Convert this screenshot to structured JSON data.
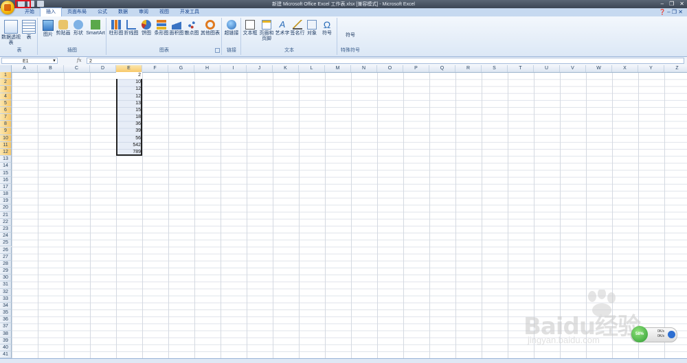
{
  "window": {
    "title": "新建 Microsoft Office Excel 工作表.xlsx [兼容模式] - Microsoft Excel",
    "controls": [
      "–",
      "❐",
      "✕"
    ]
  },
  "tabs": [
    "开始",
    "插入",
    "页面布局",
    "公式",
    "数据",
    "审阅",
    "视图",
    "开发工具"
  ],
  "active_tab": "插入",
  "ribbon": {
    "groups": [
      {
        "label": "表",
        "buttons": [
          "数据透视表",
          "表"
        ]
      },
      {
        "label": "插图",
        "buttons": [
          "图片",
          "剪贴画",
          "形状",
          "SmartArt"
        ]
      },
      {
        "label": "图表",
        "buttons": [
          "柱形图",
          "折线图",
          "饼图",
          "条形图",
          "面积图",
          "散点图",
          "其他图表"
        ]
      },
      {
        "label": "链接",
        "buttons": [
          "超链接"
        ]
      },
      {
        "label": "文本",
        "buttons": [
          "文本框",
          "页眉和页脚",
          "艺术字",
          "签名行",
          "对象",
          "符号"
        ]
      },
      {
        "label": "特殊符号",
        "buttons": [
          "符号"
        ]
      }
    ]
  },
  "formula_bar": {
    "name_box": "E1",
    "fx": "fx",
    "value": "2"
  },
  "columns": [
    "A",
    "B",
    "C",
    "D",
    "E",
    "F",
    "G",
    "H",
    "I",
    "J",
    "K",
    "L",
    "M",
    "N",
    "O",
    "P",
    "Q",
    "R",
    "S",
    "T",
    "U",
    "V",
    "W",
    "X",
    "Y",
    "Z"
  ],
  "selected_column": "E",
  "rows": [
    "1",
    "2",
    "3",
    "4",
    "5",
    "6",
    "7",
    "8",
    "9",
    "10",
    "11",
    "12",
    "13",
    "14",
    "15",
    "16",
    "17",
    "18",
    "19",
    "20",
    "21",
    "22",
    "23",
    "24",
    "25",
    "26",
    "27",
    "28",
    "29",
    "30",
    "31",
    "32",
    "33",
    "34",
    "35",
    "36",
    "37",
    "38",
    "39",
    "40",
    "41"
  ],
  "cells_E": [
    "2",
    "10",
    "12",
    "12",
    "13",
    "15",
    "18",
    "36",
    "39",
    "56",
    "542",
    "789"
  ],
  "watermark": {
    "logo": "Baidu经验",
    "url": "jingyan.baidu.com"
  },
  "speed_widget": {
    "percent": "58%",
    "up": "0K/s",
    "down": "0K/s"
  }
}
